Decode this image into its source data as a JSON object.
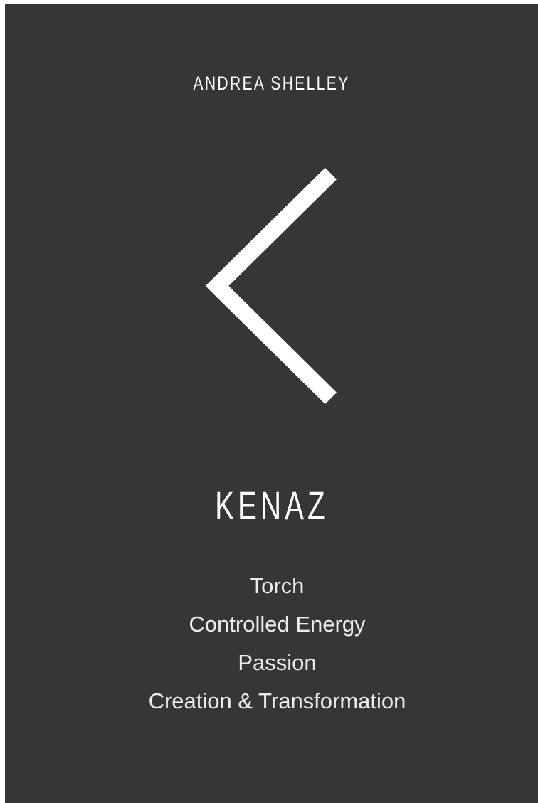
{
  "cover": {
    "author": "ANDREA SHELLEY",
    "rune_icon": "kenaz-rune-icon",
    "title": "KENAZ",
    "meanings": [
      "Torch",
      "Controlled Energy",
      "Passion",
      "Creation & Transformation"
    ],
    "colors": {
      "background": "#363636",
      "foreground": "#ffffff"
    }
  }
}
